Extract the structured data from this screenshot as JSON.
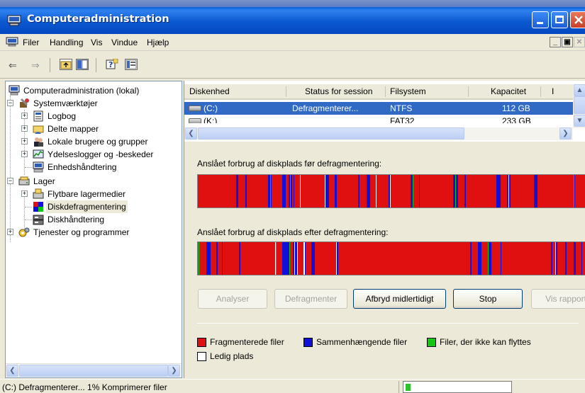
{
  "window": {
    "title": "Computeradministration"
  },
  "menu": {
    "items": [
      "Filer",
      "Handling",
      "Vis",
      "Vindue",
      "Hjælp"
    ]
  },
  "tree": {
    "root": "Computeradministration (lokal)",
    "systemtools": "Systemværktøjer",
    "logbook": "Logbog",
    "shared": "Delte mapper",
    "localusers": "Lokale brugere og grupper",
    "perflogs": "Ydelseslogger og -beskeder",
    "devmgr": "Enhedshåndtering",
    "storage": "Lager",
    "removable": "Flytbare lagermedier",
    "defrag": "Diskdefragmentering",
    "diskmgmt": "Diskhåndtering",
    "services": "Tjenester og programmer"
  },
  "volumes": {
    "columns": [
      "Diskenhed",
      "Status for session",
      "Filsystem",
      "Kapacitet",
      "I"
    ],
    "rows": [
      {
        "drive": "(C:)",
        "status": "Defragmenterer...",
        "fs": "NTFS",
        "capacity": "112 GB"
      },
      {
        "drive": "(K:)",
        "status": "",
        "fs": "FAT32",
        "capacity": "233 GB"
      }
    ]
  },
  "defrag": {
    "before_label": "Anslået forbrug af diskplads før defragmentering:",
    "after_label": "Anslået forbrug af diskplads efter defragmentering:",
    "buttons": {
      "analyze": "Analyser",
      "defragment": "Defragmenter",
      "pause": "Afbryd midlertidigt",
      "stop": "Stop",
      "report": "Vis rapport"
    },
    "legend": {
      "fragmented": "Fragmenterede filer",
      "contiguous": "Sammenhængende filer",
      "unmovable": "Filer, der ikke kan flyttes",
      "free": "Ledig plads"
    },
    "colors": {
      "fragmented": "#e01010",
      "contiguous": "#1010d8",
      "unmovable": "#10c810",
      "free": "#ffffff"
    }
  },
  "status": {
    "text": "(C:) Defragmenterer... 1% Komprimerer filer",
    "progress_fraction": 0.01
  }
}
